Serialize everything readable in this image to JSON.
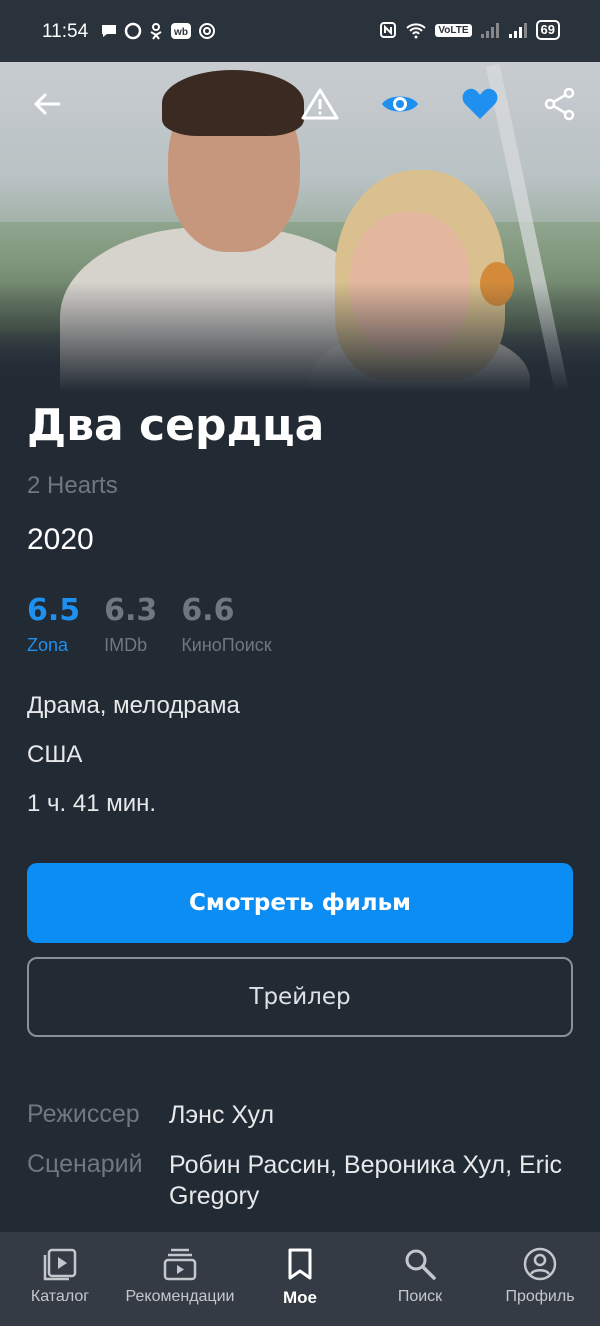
{
  "status_bar": {
    "time": "11:54",
    "volte": "VoLTE",
    "battery": "69"
  },
  "hero": {
    "icons": [
      "back-arrow-icon",
      "warning-icon",
      "eye-icon",
      "heart-icon",
      "share-icon"
    ],
    "accent_color": "#1f8ff0"
  },
  "movie": {
    "title": "Два сердца",
    "original_title": "2 Hearts",
    "year": "2020",
    "ratings": [
      {
        "value": "6.5",
        "source": "Zona",
        "color": "#1e90f0"
      },
      {
        "value": "6.3",
        "source": "IMDb",
        "color": "#6f7780"
      },
      {
        "value": "6.6",
        "source": "КиноПоиск",
        "color": "#6f7780"
      }
    ],
    "genres": "Драма, мелодрама",
    "country": "США",
    "duration": "1 ч. 41 мин."
  },
  "buttons": {
    "watch": "Смотреть фильм",
    "trailer": "Трейлер"
  },
  "credits": {
    "director_label": "Режиссер",
    "director": "Лэнс Хул",
    "writers_label": "Сценарий",
    "writers": "Робин Рассин, Вероника Хул, Eric Gregory"
  },
  "bottom_nav": {
    "items": [
      {
        "label": "Каталог",
        "icon": "catalog-icon"
      },
      {
        "label": "Рекомендации",
        "icon": "recommendations-icon"
      },
      {
        "label": "Мое",
        "icon": "bookmark-icon",
        "active": true
      },
      {
        "label": "Поиск",
        "icon": "search-icon"
      },
      {
        "label": "Профиль",
        "icon": "profile-icon"
      }
    ]
  }
}
